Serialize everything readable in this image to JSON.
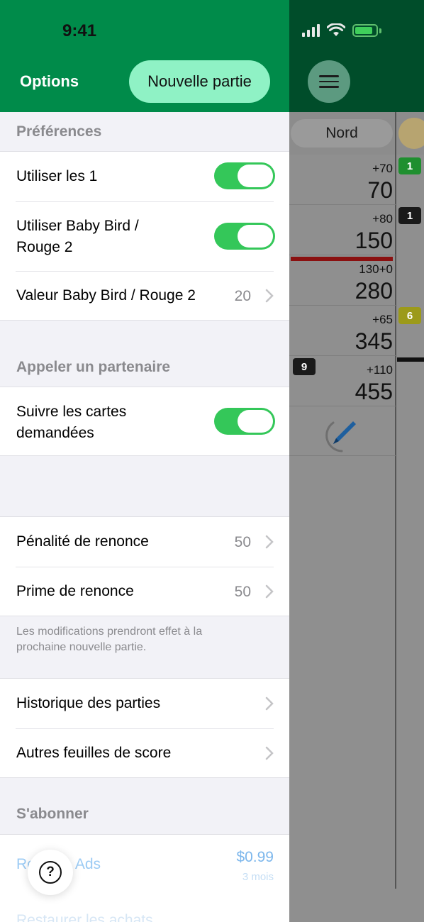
{
  "status_bar": {
    "time": "9:41"
  },
  "header": {
    "title": "Options",
    "new_game_label": "Nouvelle partie"
  },
  "sections": {
    "preferences": {
      "title": "Préférences",
      "items": [
        {
          "label": "Utiliser les 1",
          "toggle": true
        },
        {
          "label": "Utiliser Baby Bird / Rouge 2",
          "label_line1": "Utiliser Baby Bird /",
          "label_line2": "Rouge 2",
          "toggle": true
        },
        {
          "label": "Valeur Baby Bird / Rouge 2",
          "value": "20"
        }
      ]
    },
    "partner": {
      "title": "Appeler un partenaire",
      "items": [
        {
          "label": "Suivre les cartes demandées",
          "label_line1": "Suivre les cartes",
          "label_line2": "demandées",
          "toggle": true
        }
      ]
    },
    "renege": {
      "items": [
        {
          "label": "Pénalité de renonce",
          "value": "50"
        },
        {
          "label": "Prime de renonce",
          "value": "50"
        }
      ],
      "footer_line1": "Les modifications prendront effet à la",
      "footer_line2": "prochaine nouvelle partie."
    },
    "history": {
      "items": [
        {
          "label": "Historique des parties"
        },
        {
          "label": "Autres feuilles de score"
        }
      ]
    },
    "subscribe": {
      "title": "S'abonner",
      "remove_ads_label": "Remove Ads",
      "price": "$0.99",
      "price_period": "3 mois",
      "restore_label": "Restaurer les achats"
    }
  },
  "scoresheet": {
    "column_header": "Nord",
    "rows": [
      {
        "delta": "+70",
        "total": "70"
      },
      {
        "delta": "+80",
        "total": "150"
      },
      {
        "delta": "130+0",
        "total": "280"
      },
      {
        "delta": "+65",
        "total": "345"
      },
      {
        "delta": "+110",
        "total": "455"
      }
    ],
    "badges": [
      {
        "text": "1",
        "color": "#1f8f2f"
      },
      {
        "text": "1",
        "color": "#1a1a1a"
      },
      {
        "text": "6",
        "color": "#9c9a1a"
      },
      {
        "text": "9",
        "color": "#1a1a1a"
      }
    ]
  },
  "colors": {
    "accent_green": "#008b4a",
    "toggle_on": "#34c759",
    "button_mint": "#8ff2c5",
    "link_blue": "#7db7ec"
  }
}
